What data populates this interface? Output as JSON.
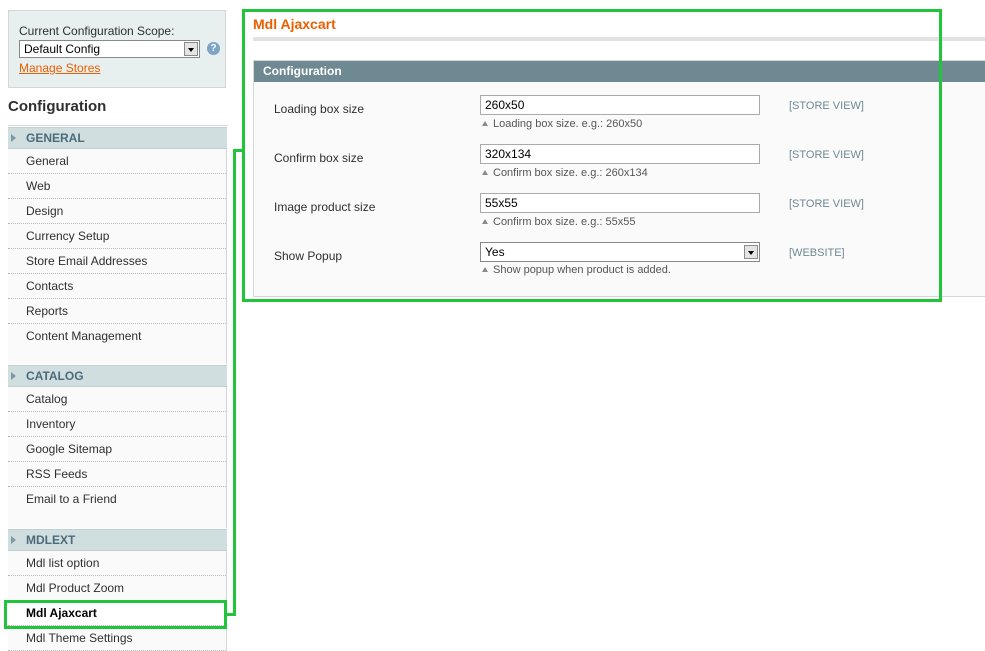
{
  "scope": {
    "label": "Current Configuration Scope:",
    "selected": "Default Config",
    "manage_stores": "Manage Stores"
  },
  "sidebar": {
    "title": "Configuration",
    "groups": [
      {
        "label": "GENERAL",
        "items": [
          "General",
          "Web",
          "Design",
          "Currency Setup",
          "Store Email Addresses",
          "Contacts",
          "Reports",
          "Content Management"
        ]
      },
      {
        "label": "CATALOG",
        "items": [
          "Catalog",
          "Inventory",
          "Google Sitemap",
          "RSS Feeds",
          "Email to a Friend"
        ]
      },
      {
        "label": "MDLEXT",
        "items": [
          "Mdl list option",
          "Mdl Product Zoom",
          "Mdl Ajaxcart",
          "Mdl Theme Settings"
        ]
      }
    ],
    "active_item": "Mdl Ajaxcart"
  },
  "main": {
    "title": "Mdl Ajaxcart",
    "section_title": "Configuration",
    "fields": [
      {
        "label": "Loading box size",
        "value": "260x50",
        "hint": "Loading box size. e.g.: 260x50",
        "scope": "[STORE VIEW]"
      },
      {
        "label": "Confirm box size",
        "value": "320x134",
        "hint": "Confirm box size. e.g.: 260x134",
        "scope": "[STORE VIEW]"
      },
      {
        "label": "Image product size",
        "value": "55x55",
        "hint": "Confirm box size. e.g.: 55x55",
        "scope": "[STORE VIEW]"
      },
      {
        "label": "Show Popup",
        "value": "Yes",
        "hint": "Show popup when product is added.",
        "scope": "[WEBSITE]"
      }
    ]
  },
  "colors": {
    "accent_orange": "#eb5e00",
    "section_header": "#6f8992",
    "highlight_green": "#22c43c"
  }
}
